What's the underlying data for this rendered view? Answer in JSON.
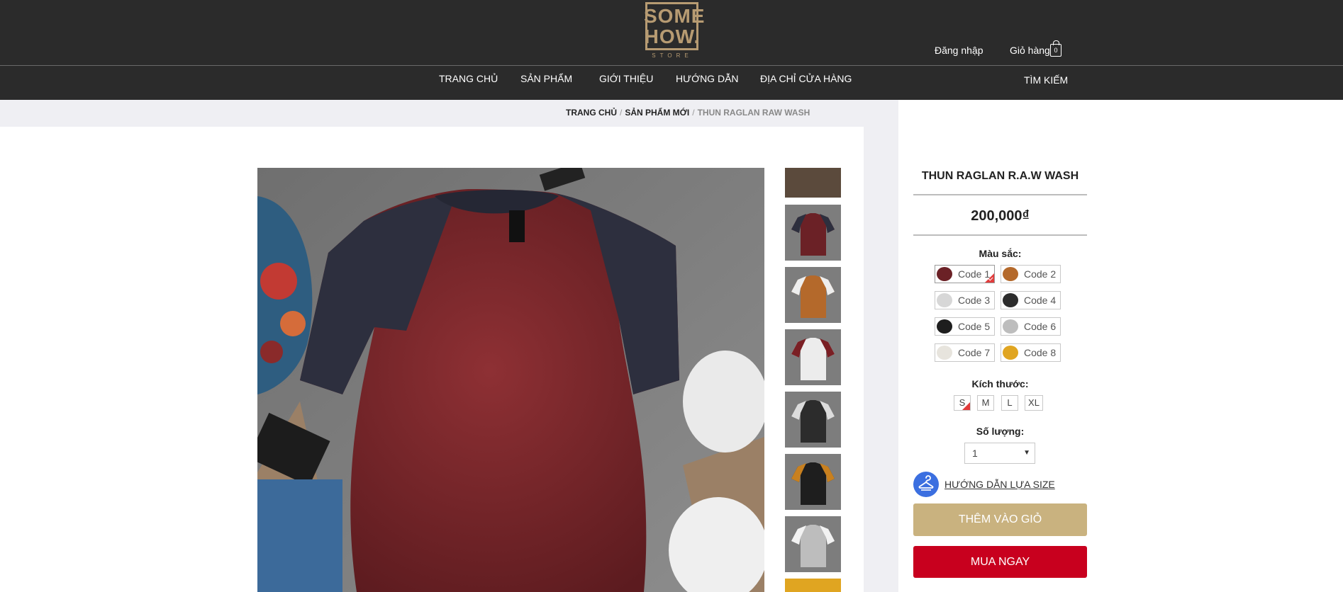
{
  "header": {
    "logo_line1": "SOME",
    "logo_line2": "HOW.",
    "logo_line3": "STORE",
    "login": "Đăng nhập",
    "cart": "Giỏ hàng",
    "cart_count": "0"
  },
  "nav": {
    "home": "TRANG CHỦ",
    "products": "SẢN PHẨM",
    "about": "GIỚI THIỆU",
    "guide": "HƯỚNG DẪN",
    "stores": "ĐỊA CHỈ CỬA HÀNG",
    "search": "TÌM KIẾM"
  },
  "breadcrumb": {
    "home": "TRANG CHỦ",
    "category": "SẢN PHẨM MỚI",
    "current": "THUN RAGLAN RAW WASH"
  },
  "product": {
    "title": "THUN RAGLAN R.A.W WASH",
    "price": "200,000₫",
    "color_label": "Màu sắc:",
    "colors": [
      {
        "label": "Code 1",
        "color": "#6b2126",
        "selected": true
      },
      {
        "label": "Code 2",
        "color": "#b4692b",
        "selected": false
      },
      {
        "label": "Code 3",
        "color": "#d7d7d7",
        "selected": false
      },
      {
        "label": "Code 4",
        "color": "#2c2c2c",
        "selected": false
      },
      {
        "label": "Code 5",
        "color": "#1e1e1e",
        "selected": false
      },
      {
        "label": "Code 6",
        "color": "#bdbdbd",
        "selected": false
      },
      {
        "label": "Code 7",
        "color": "#e7e4dd",
        "selected": false
      },
      {
        "label": "Code 8",
        "color": "#e0a521",
        "selected": false
      }
    ],
    "size_label": "Kích thước:",
    "sizes": [
      {
        "label": "S",
        "selected": true
      },
      {
        "label": "M",
        "selected": false
      },
      {
        "label": "L",
        "selected": false
      },
      {
        "label": "XL",
        "selected": false
      }
    ],
    "qty_label": "Số lượng:",
    "qty_value": "1",
    "size_guide": "HƯỚNG DẪN LỰA SIZE",
    "add_to_cart": "THÊM VÀO GIỎ",
    "buy_now": "MUA NGAY"
  },
  "colors": {
    "header_bg": "#2b2b2b",
    "gold": "#c9b27f",
    "red": "#c8001e",
    "accent_blue": "#3b6fe0"
  }
}
